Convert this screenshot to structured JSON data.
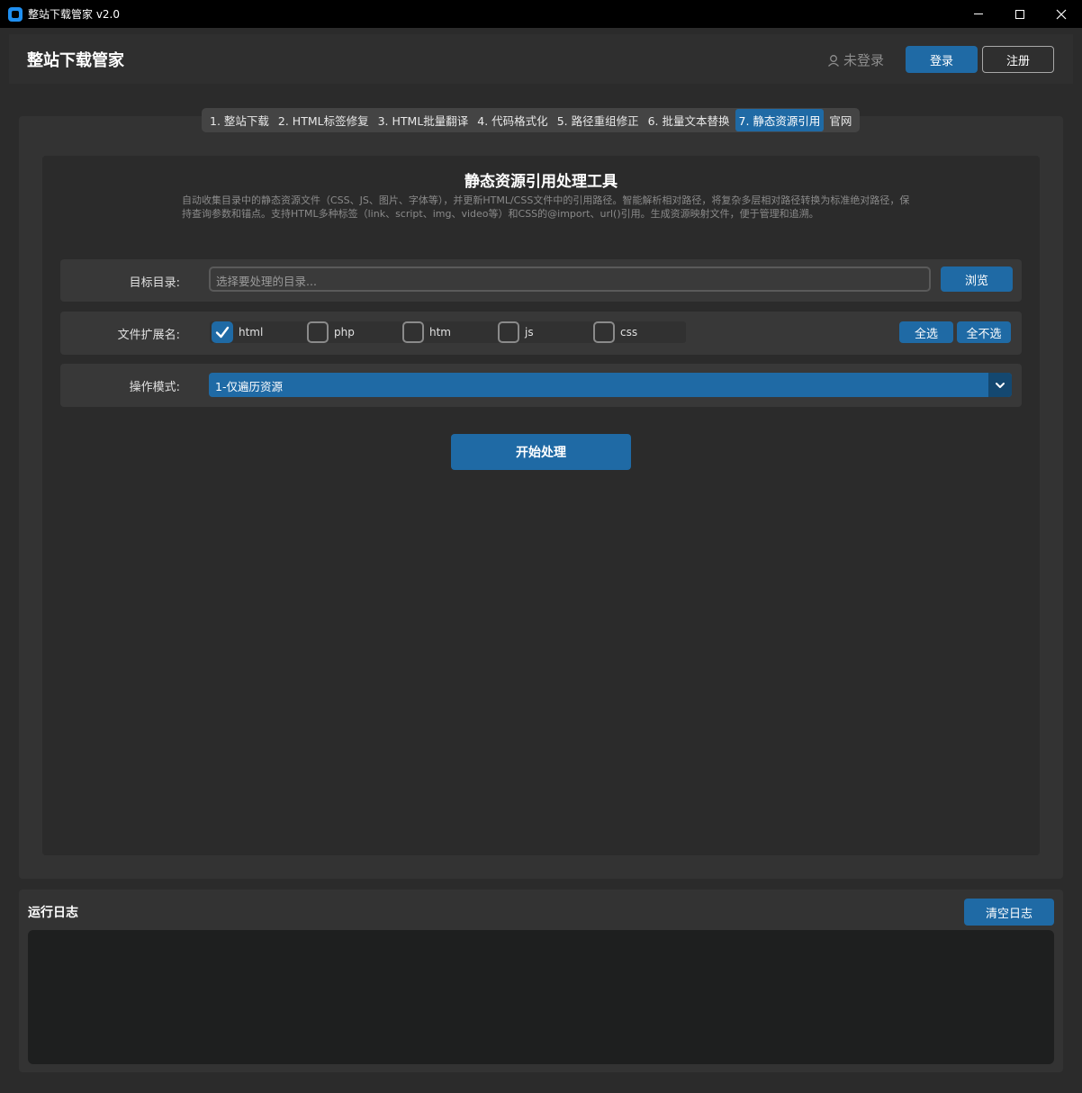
{
  "window": {
    "title": "整站下载管家 v2.0",
    "icon": "app-icon",
    "controls": [
      "minimize-icon",
      "maximize-icon",
      "close-icon"
    ]
  },
  "header": {
    "app_title": "整站下载管家",
    "login_status": "未登录",
    "login_button": "登录",
    "register_button": "注册"
  },
  "tabs": [
    {
      "label": "1. 整站下载",
      "active": false
    },
    {
      "label": "2. HTML标签修复",
      "active": false
    },
    {
      "label": "3. HTML批量翻译",
      "active": false
    },
    {
      "label": "4. 代码格式化",
      "active": false
    },
    {
      "label": "5. 路径重组修正",
      "active": false
    },
    {
      "label": "6. 批量文本替换",
      "active": false
    },
    {
      "label": "7. 静态资源引用",
      "active": true
    },
    {
      "label": "官网",
      "active": false
    }
  ],
  "tool": {
    "title": "静态资源引用处理工具",
    "description": "自动收集目录中的静态资源文件（CSS、JS、图片、字体等），并更新HTML/CSS文件中的引用路径。智能解析相对路径，将复杂多层相对路径转换为标准绝对路径，保持查询参数和锚点。支持HTML多种标签（link、script、img、video等）和CSS的@import、url()引用。生成资源映射文件，便于管理和追溯。",
    "target_dir": {
      "label": "目标目录:",
      "placeholder": "选择要处理的目录...",
      "value": "",
      "browse_button": "浏览"
    },
    "extensions": {
      "label": "文件扩展名:",
      "items": [
        {
          "name": "html",
          "checked": true
        },
        {
          "name": "php",
          "checked": false
        },
        {
          "name": "htm",
          "checked": false
        },
        {
          "name": "js",
          "checked": false
        },
        {
          "name": "css",
          "checked": false
        }
      ],
      "select_all": "全选",
      "select_none": "全不选"
    },
    "mode": {
      "label": "操作模式:",
      "selected": "1-仅遍历资源"
    },
    "start_button": "开始处理"
  },
  "log": {
    "title": "运行日志",
    "clear_button": "清空日志",
    "content": ""
  },
  "colors": {
    "accent": "#1f6aa5",
    "background": "#2b2b2b",
    "panel": "#333333"
  }
}
